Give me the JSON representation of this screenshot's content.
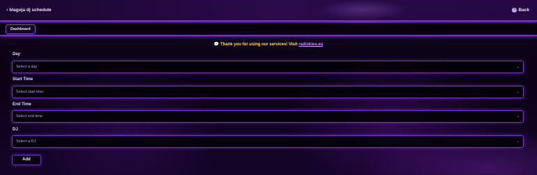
{
  "header": {
    "title": "blagoja dj schedule",
    "title_icon": "chevron-right-icon",
    "back_label": "Back",
    "back_icon": "info-icon"
  },
  "nav": {
    "dashboard_label": "Dashboard"
  },
  "notice": {
    "icon": "speech-bubble-icon",
    "text": "Thank you for using our services! Visit",
    "link_text": "radiokies.eu"
  },
  "form": {
    "day": {
      "label": "Day",
      "placeholder": "Select a day"
    },
    "start_time": {
      "label": "Start Time",
      "placeholder": "Select start time"
    },
    "end_time": {
      "label": "End Time",
      "placeholder": "Select end time"
    },
    "dj": {
      "label": "DJ",
      "placeholder": "Select a DJ"
    },
    "add_label": "Add"
  },
  "colors": {
    "accent": "#7a2fd0",
    "notice": "#ffe14a",
    "link": "#d18cff"
  }
}
